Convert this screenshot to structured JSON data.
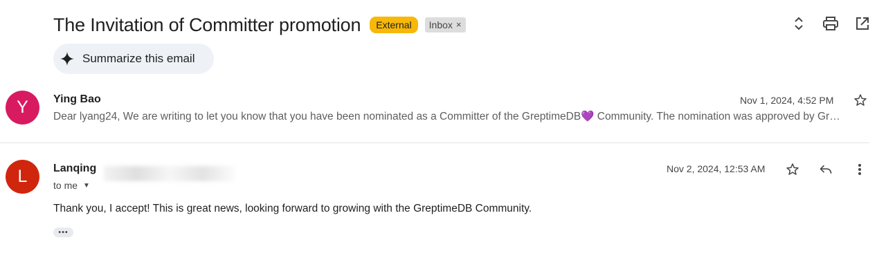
{
  "header": {
    "subject": "The Invitation of Committer promotion",
    "labels": {
      "external": "External",
      "inbox": "Inbox",
      "inbox_remove": "×"
    },
    "actions": [
      "expand-collapse-icon",
      "print-icon",
      "open-in-new-window-icon"
    ]
  },
  "summarize": {
    "label": "Summarize this email",
    "icon": "sparkle-icon"
  },
  "messages": [
    {
      "avatar_letter": "Y",
      "avatar_color": "#d81b60",
      "sender": "Ying Bao",
      "date": "Nov 1, 2024, 4:52 PM",
      "snippet_before": "Dear lyang24, We are writing to let you know that you have been nominated as a Committer of the GreptimeDB",
      "snippet_emoji": "💜",
      "snippet_after": " Community. The nomination was approved by Gr…"
    },
    {
      "avatar_letter": "L",
      "avatar_color": "#d0260e",
      "sender": "Lanqing",
      "date": "Nov 2, 2024, 12:53 AM",
      "recipient": "to me",
      "body": "Thank you, I accept! This is great news, looking forward to growing with the GreptimeDB Community.",
      "trimmed_content": "•••"
    }
  ],
  "colors": {
    "external_badge": "#f7b80a",
    "inbox_badge": "#dddddd",
    "summarize_bg": "#eef2f6"
  }
}
